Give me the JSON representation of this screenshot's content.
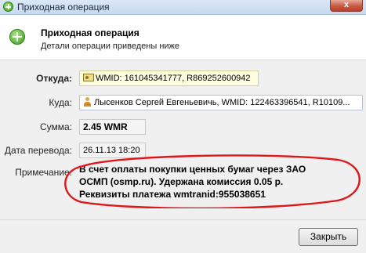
{
  "window": {
    "title": "Приходная операция",
    "close_label": "x"
  },
  "header": {
    "title": "Приходная операция",
    "subtitle": "Детали операции приведены ниже"
  },
  "form": {
    "from_label": "Откуда:",
    "from_value": "WMID: 161045341777, R869252600942",
    "to_label": "Куда:",
    "to_value": "Лысенков Сергей Евгеньевичь, WMID: 122463396541, R10109...",
    "amount_label": "Сумма:",
    "amount_value": "2.45 WMR",
    "date_label": "Дата перевода:",
    "date_value": "26.11.13 18:20",
    "note_label": "Примечание:",
    "note_lines": [
      "В счет оплаты покупки ценных бумаг через ЗАО",
      "ОСМП (osmp.ru). Удержана комиссия 0.05 р.",
      "Реквизиты платежа wmtranid:955038651"
    ]
  },
  "footer": {
    "close_button": "Закрыть"
  },
  "colors": {
    "annotation": "#e0161b",
    "yellow_field": "#fffde0"
  }
}
